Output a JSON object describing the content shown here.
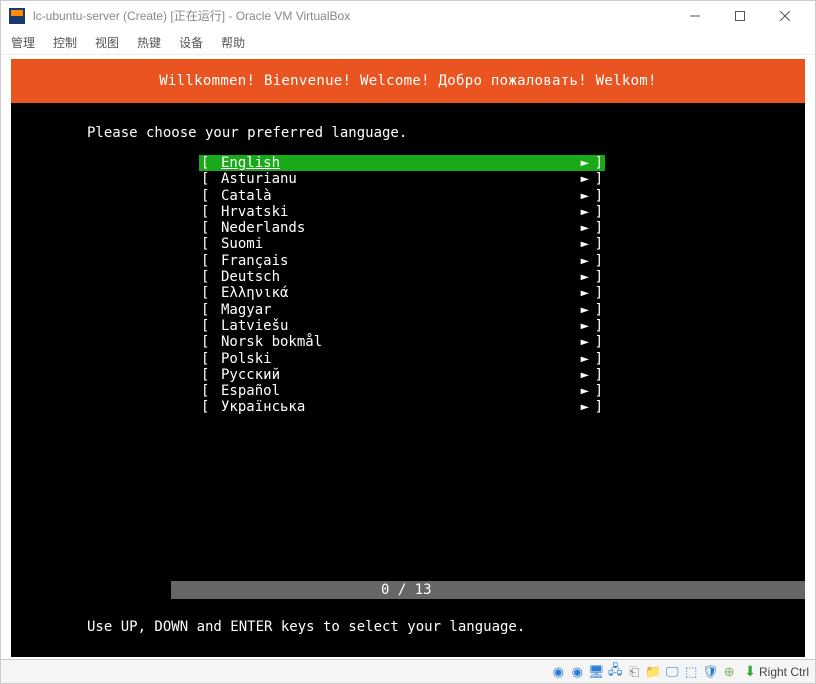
{
  "window": {
    "title": "lc-ubuntu-server (Create) [正在运行] - Oracle VM VirtualBox"
  },
  "menu": {
    "items": [
      "管理",
      "控制",
      "视图",
      "热键",
      "设备",
      "帮助"
    ]
  },
  "installer": {
    "banner": "Willkommen! Bienvenue! Welcome! Добро пожаловать! Welkom!",
    "prompt": "Please choose your preferred language.",
    "progress": "0 / 13",
    "help": "Use UP, DOWN and ENTER keys to select your language.",
    "languages": [
      "English",
      "Asturianu",
      "Català",
      "Hrvatski",
      "Nederlands",
      "Suomi",
      "Français",
      "Deutsch",
      "Ελληνικά",
      "Magyar",
      "Latviešu",
      "Norsk bokmål",
      "Polski",
      "Русский",
      "Español",
      "Українська"
    ],
    "selected_index": 0,
    "arrow": "►",
    "bracket_l": "[",
    "bracket_r": "]"
  },
  "statusbar": {
    "host_key": "Right Ctrl"
  }
}
